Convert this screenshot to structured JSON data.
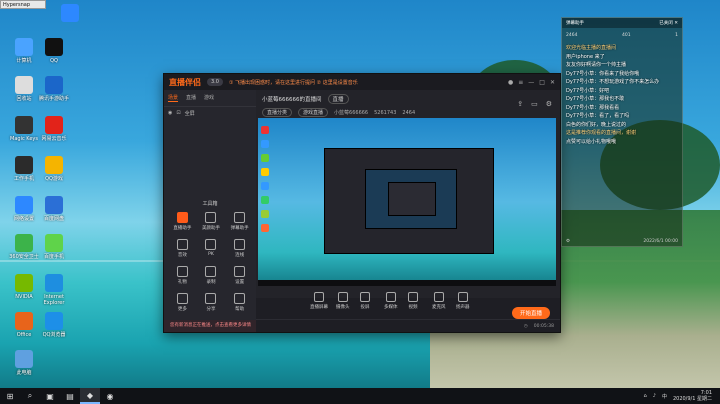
{
  "hypersnap": {
    "title": "Hypersnap"
  },
  "desktop_icons": [
    {
      "label": "",
      "color": "#2d88ff"
    },
    {
      "label": "计算机",
      "color": "#4aa3ff"
    },
    {
      "label": "QQ",
      "color": "#111"
    },
    {
      "label": "回收站",
      "color": "#ddd"
    },
    {
      "label": "腾讯手游助手",
      "color": "#1b66c9"
    },
    {
      "label": "Magic Keys",
      "color": "#333"
    },
    {
      "label": "网易云音乐",
      "color": "#e2231a"
    },
    {
      "label": "工作手机",
      "color": "#2b2b2b"
    },
    {
      "label": "QQ游戏",
      "color": "#f5b400"
    },
    {
      "label": "网络设置",
      "color": "#2d88ff"
    },
    {
      "label": "百度网盘",
      "color": "#2b6fd6"
    },
    {
      "label": "360安全卫士",
      "color": "#3cb34a"
    },
    {
      "label": "百度手机",
      "color": "#5fd34a"
    },
    {
      "label": "NVIDIA",
      "color": "#76b900"
    },
    {
      "label": "Internet Explorer",
      "color": "#1e8ee0"
    },
    {
      "label": "Office",
      "color": "#e8641b"
    },
    {
      "label": "QQ浏览器",
      "color": "#1d8fe8"
    },
    {
      "label": "此电脑",
      "color": "#5fa0e0"
    }
  ],
  "app": {
    "logo": "直播伴侣",
    "version": "3.0",
    "notice": "① 飞播出现困惑时，请在这里进行提问 ② 这里是设置音乐",
    "tabs": [
      "场景",
      "直播",
      "游戏"
    ],
    "scene_label": "全屏",
    "tools_title": "工具箱",
    "tools": [
      {
        "label": "直播助手",
        "hot": true
      },
      {
        "label": "美颜助手",
        "hot": false
      },
      {
        "label": "弹幕助手",
        "hot": false
      },
      {
        "label": "音效",
        "hot": false
      },
      {
        "label": "PK",
        "hot": false
      },
      {
        "label": "连线",
        "hot": false
      },
      {
        "label": "礼物",
        "hot": false
      },
      {
        "label": "录制",
        "hot": false
      },
      {
        "label": "设置",
        "hot": false
      },
      {
        "label": "更多",
        "hot": false
      },
      {
        "label": "分享",
        "hot": false
      },
      {
        "label": "帮助",
        "hot": false
      }
    ],
    "warning": "您有新消息正在推送，点击查看更多详情",
    "room_title": "小蓝莓666666的直播间",
    "room_badge": "直播",
    "room_tags": [
      "直播分类",
      "游戏直播"
    ],
    "room_meta_id": "小蓝莓666666",
    "room_meta_fans": "5261743",
    "room_meta_viewers": "2464",
    "bottom_tools": [
      "直播屏幕",
      "摄像头",
      "投屏",
      "多媒体",
      "视频",
      "麦克风",
      "扬声器"
    ],
    "start_button": "开始直播",
    "time": "00:05:38"
  },
  "chat": {
    "title": "弹幕助手",
    "close": "已关闭 ✕",
    "stats": [
      "2464",
      "401",
      "1"
    ],
    "messages": [
      {
        "text": "欢迎光临主播的直播间",
        "sys": true
      },
      {
        "text": "用户iphone 来了",
        "sys": false
      },
      {
        "text": "友友你好啊请你一个帅主播",
        "sys": false
      },
      {
        "text": "Dy77号小草：你看来了我给你哦",
        "sys": false
      },
      {
        "text": "Dy77号小草：不想玩游戏了你不来怎么办",
        "sys": false
      },
      {
        "text": "Dy77号小草：好吧",
        "sys": false
      },
      {
        "text": "Dy77号小草：那我也不敢",
        "sys": false
      },
      {
        "text": "Dy77号小草：那我看看",
        "sys": false
      },
      {
        "text": "Dy77号小草：看了，看了吗",
        "sys": false
      },
      {
        "text": "白色的你们好，晚上说过的",
        "sys": false
      },
      {
        "text": "这是推荐你观看的直播间，谢谢",
        "sys": true
      },
      {
        "text": "点赞可以给小礼物哦哦",
        "sys": false
      }
    ],
    "footer_left": "⚙",
    "footer_right": "2022/6/1 00:00"
  },
  "taskbar": {
    "start_icon": "windows-icon",
    "items": [
      "search-icon",
      "task-view-icon",
      "explorer-icon",
      "live-app-icon",
      "browser-icon"
    ],
    "tray_lang": "中",
    "time": "7:01",
    "date": "2020/9/1 星期二"
  }
}
